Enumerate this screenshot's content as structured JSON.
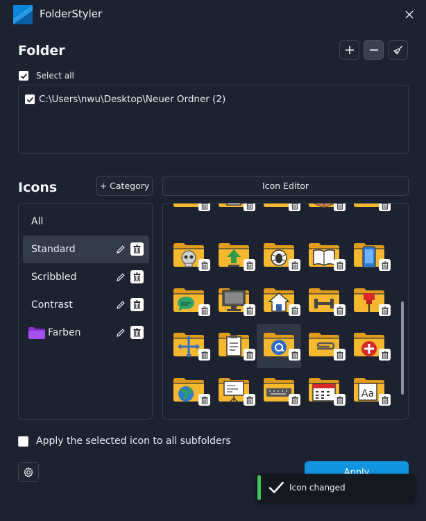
{
  "window": {
    "title": "FolderStyler",
    "logo_color": "#0a84d6"
  },
  "folder_section": {
    "heading": "Folder",
    "select_all_label": "Select all",
    "select_all_checked": true,
    "folders": [
      {
        "path": "C:\\Users\\nwu\\Desktop\\Neuer Ordner (2)",
        "checked": true
      }
    ]
  },
  "icons_section": {
    "heading": "Icons",
    "add_category_label": "+ Category",
    "icon_editor_label": "Icon Editor",
    "categories": [
      {
        "label": "All",
        "editable": false,
        "selected": false
      },
      {
        "label": "Standard",
        "editable": true,
        "selected": true
      },
      {
        "label": "Scribbled",
        "editable": true,
        "selected": false
      },
      {
        "label": "Contrast",
        "editable": true,
        "selected": false
      },
      {
        "label": "Farben",
        "editable": true,
        "selected": false,
        "folder_color": "#8b2fd6"
      }
    ],
    "icon_grid": [
      [
        "shuffle-folder-icon",
        "floppy-folder-icon",
        "gamepad-folder-icon",
        "box-folder-icon",
        "key-folder-icon"
      ],
      [
        "skull-folder-icon",
        "upload-folder-icon",
        "bug-folder-icon",
        "book-folder-icon",
        "phone-folder-icon"
      ],
      [
        "chat-folder-icon",
        "monitor-folder-icon",
        "home-folder-icon",
        "gym-folder-icon",
        "pin-folder-icon"
      ],
      [
        "move-folder-icon",
        "clipboard-folder-icon",
        "at-folder-icon",
        "paperclip-folder-icon",
        "add-folder-icon"
      ],
      [
        "globe-folder-icon",
        "presentation-folder-icon",
        "keyboard-folder-icon",
        "calendar-folder-icon",
        "font-folder-icon"
      ]
    ],
    "selected_icon": "at-folder-icon"
  },
  "apply_to_subfolders_label": "Apply the selected icon to all subfolders",
  "apply_to_subfolders_checked": false,
  "apply_label": "Apply",
  "toast": {
    "message": "Icon changed",
    "accent": "#3fc35a"
  },
  "colors": {
    "folder_yellow": "#f5b82e",
    "apply_blue": "#1294e0"
  }
}
